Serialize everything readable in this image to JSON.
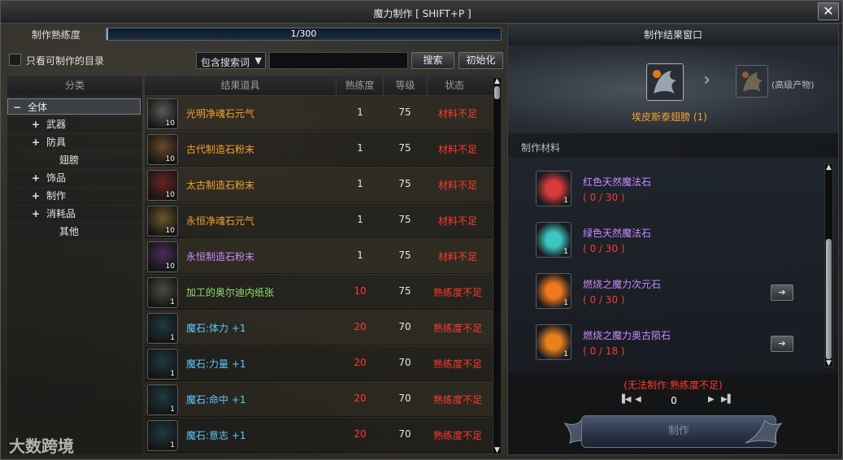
{
  "window": {
    "title": "魔力制作 [ SHIFT+P ]",
    "close_label": "✕"
  },
  "proficiency": {
    "label": "制作熟练度",
    "text": "1/300",
    "fraction": 0.0033
  },
  "filter": {
    "checkbox_label": "只看可制作的目录",
    "dropdown_value": "包含搜索词",
    "search_value": "",
    "search_button": "搜索",
    "reset_button": "初始化"
  },
  "categories": {
    "header": "分类",
    "items": [
      {
        "sign": "−",
        "label": "全体"
      },
      {
        "sign": "+",
        "label": "武器"
      },
      {
        "sign": "+",
        "label": "防具"
      },
      {
        "sign": "",
        "label": "翅膀"
      },
      {
        "sign": "+",
        "label": "饰品"
      },
      {
        "sign": "+",
        "label": "制作"
      },
      {
        "sign": "+",
        "label": "消耗品"
      },
      {
        "sign": "",
        "label": "其他"
      }
    ]
  },
  "results": {
    "headers": {
      "name": "结果道具",
      "prof": "熟练度",
      "level": "等级",
      "status": "状态"
    },
    "rows": [
      {
        "icon": "soul-essence-icon",
        "count": "10",
        "name": "光明净魂石元气",
        "prof": "1",
        "level": "75",
        "status": "材料不足",
        "name_color": "#f4a030",
        "prof_color": "#e4e4e4",
        "icon_bg": "#5a5a5a"
      },
      {
        "icon": "stone-powder-icon",
        "count": "10",
        "name": "古代制造石粉末",
        "prof": "1",
        "level": "75",
        "status": "材料不足",
        "name_color": "#f4a030",
        "prof_color": "#e4e4e4",
        "icon_bg": "#6a4a28"
      },
      {
        "icon": "stone-powder-icon",
        "count": "10",
        "name": "太古制造石粉末",
        "prof": "1",
        "level": "75",
        "status": "材料不足",
        "name_color": "#f4a030",
        "prof_color": "#e4e4e4",
        "icon_bg": "#6a2424"
      },
      {
        "icon": "soul-essence-icon",
        "count": "10",
        "name": "永恒净魂石元气",
        "prof": "1",
        "level": "75",
        "status": "材料不足",
        "name_color": "#f4a030",
        "prof_color": "#e4e4e4",
        "icon_bg": "#6a5a2a"
      },
      {
        "icon": "stone-powder-icon",
        "count": "10",
        "name": "永恒制造石粉末",
        "prof": "1",
        "level": "75",
        "status": "材料不足",
        "name_color": "#c98bff",
        "prof_color": "#e4e4e4",
        "icon_bg": "#4a2a5a"
      },
      {
        "icon": "paper-scroll-icon",
        "count": "1",
        "name": "加工的奥尔迪内纸张",
        "prof": "10",
        "level": "75",
        "status": "熟练度不足",
        "name_color": "#8fe070",
        "prof_color": "#ff3a2e",
        "icon_bg": "#4a4a44"
      },
      {
        "icon": "magic-stone-icon",
        "count": "1",
        "name": "魔石:体力 +1",
        "prof": "20",
        "level": "70",
        "status": "熟练度不足",
        "name_color": "#5ec8ff",
        "prof_color": "#ff3a2e",
        "icon_bg": "#1e3a40"
      },
      {
        "icon": "magic-stone-icon",
        "count": "1",
        "name": "魔石:力量 +1",
        "prof": "20",
        "level": "70",
        "status": "熟练度不足",
        "name_color": "#5ec8ff",
        "prof_color": "#ff3a2e",
        "icon_bg": "#1e3a40"
      },
      {
        "icon": "magic-stone-icon",
        "count": "1",
        "name": "魔石:命中 +1",
        "prof": "20",
        "level": "70",
        "status": "熟练度不足",
        "name_color": "#5ec8ff",
        "prof_color": "#ff3a2e",
        "icon_bg": "#1e3a40"
      },
      {
        "icon": "magic-stone-icon",
        "count": "1",
        "name": "魔石:意志 +1",
        "prof": "20",
        "level": "70",
        "status": "熟练度不足",
        "name_color": "#5ec8ff",
        "prof_color": "#ff3a2e",
        "icon_bg": "#1e3a40"
      }
    ]
  },
  "result_window": {
    "title": "制作结果窗口",
    "result_name": "埃皮斯泰翅膀 (1)",
    "advanced_label": "(高级产物)",
    "materials_header": "制作材料",
    "materials": [
      {
        "name": "红色天然魔法石",
        "count": "( 0 / 30 )",
        "qty": "1",
        "icon": "red-crystal-icon",
        "color": "#d83a3a"
      },
      {
        "name": "绿色天然魔法石",
        "count": "( 0 / 30 )",
        "qty": "1",
        "icon": "teal-crystal-icon",
        "color": "#3ac8c0"
      },
      {
        "name": "燃烧之魔力次元石",
        "count": "( 0 / 30 )",
        "qty": "1",
        "icon": "orange-gem-icon",
        "color": "#f07820",
        "has_link": true
      },
      {
        "name": "燃烧之魔力奥古陨石",
        "count": "( 0 / 18 )",
        "qty": "1",
        "icon": "swirl-stone-icon",
        "color": "#e8801c",
        "has_link": true
      }
    ],
    "warning": "(无法制作:熟练度不足)",
    "quantity": "0",
    "craft_button": "制作"
  },
  "watermark": "大数跨境"
}
